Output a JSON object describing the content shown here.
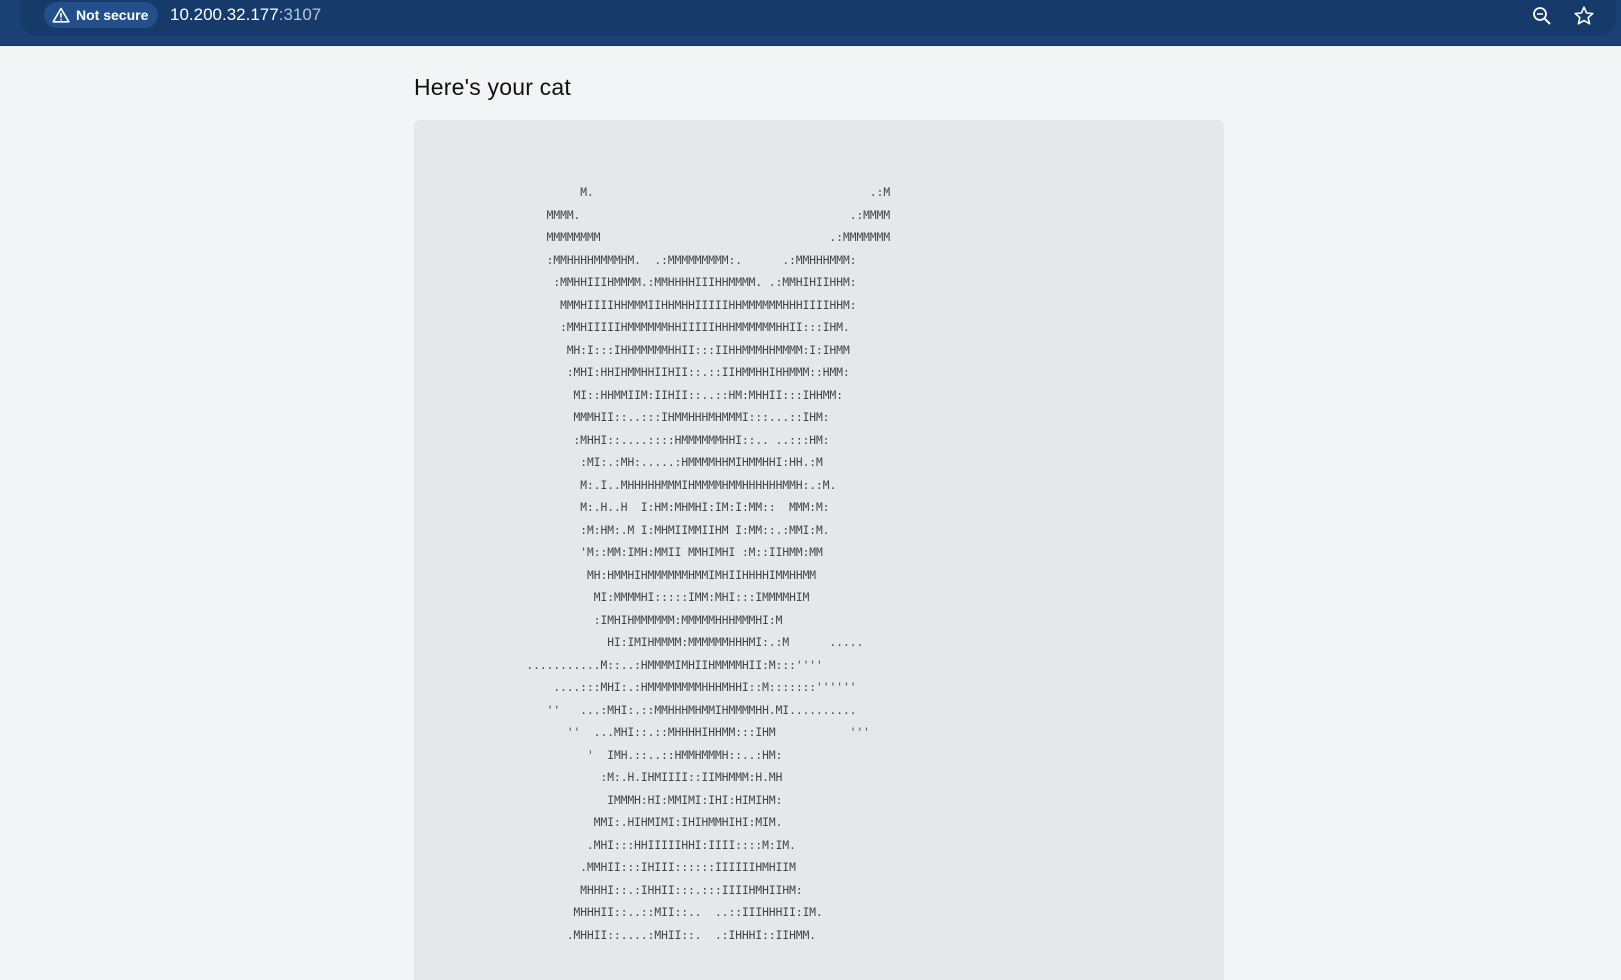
{
  "browser": {
    "security_label": "Not secure",
    "url_host": "10.200.32.177",
    "url_port": ":3107"
  },
  "page": {
    "heading": "Here's your cat"
  },
  "cat_ascii": "              M.                                         .:M\n         MMMM.                                        .:MMMM\n         MMMMMMMM                                  .:MMMMMMM\n         :MMHHHHMMMMHM.  .:MMMMMMMMM:.      .:MMHHHMMM:\n          :MMHHIIIHMMMM.:MMHHHHIIIHHMMMM. .:MMHIHIIHHM:\n           MMMHIIIIHHMMMIIHHMHHIIIIIHHMMMMMMHHHIIIIHHM:\n           :MMHIIIIIHMMMMMMHHIIIIIHHHMMMMMMHHII:::IHM.\n            MH:I:::IHHMMMMMHHII:::IIHHMMMHHMMMM:I:IHMM\n            :MHI:HHIHMMHHIIHII::.::IIHMMHHIHHMMM::HMM:\n             MI::HHMMIIM:IIHII::..::HM:MHHII:::IHHMM:\n             MMMHII::..:::IHMMHHHMHMMMI:::...::IHM:\n             :MHHI::....::::HMMMMMMHHI::.. ..:::HM:\n              :MI:.:MH:.....:HMMMMHHMIHMMHHI:HH.:M\n              M:.I..MHHHHHMMMIHMMMMHMMHHHHHHMMH:.:M.\n              M:.H..H  I:HM:MHMHI:IM:I:MM::  MMM:M:\n              :M:HM:.M I:MHMIIMMIIHM I:MM::.:MMI:M.\n              'M::MM:IMH:MMII MMHIMHI :M::IIHMM:MM\n               MH:HMMHIHMMMMMMHMMIMHIIHHHHIMMHHMM\n                MI:MMMMHI:::::IMM:MHI:::IMMMMHIM\n                :IMHIHMMMMMM:MMMMMHHHMMMHI:M\n                  HI:IMIHMMMM:MMMMMMHHHMI:.:M      .....\n      ...........M::..:HMMMMIMHIIHMMMMHII:M:::''''\n          ....:::MHI:.:HMMMMMMMMHHHMHHI::M:::::::''''''\n         ''   ...:MHI:.::MMHHHMHMMIHMMMMHH.MI..........\n            ''  ...MHI::.::MHHHHIHHMM:::IHM           '''\n               '  IMH.::..::HMMHMMMH::..:HM:\n                 :M:.H.IHMIIII::IIMHMMM:H.MH\n                  IMMMH:HI:MMIMI:IHI:HIMIHM:\n                MMI:.HIHMIMI:IHIHMMHIHI:MIM.\n               .MHI:::HHIIIIIHHI:IIII::::M:IM.\n              .MMHII:::IHIII::::::IIIIIIHMHIIM\n              MHHHI::.:IHHII:::.:::IIIIHMHIIHM:\n             MHHHII::..::MII::..  ..::IIIHHHII:IM.\n            .MHHII::....:MHII::.  .:IHHHI::IIHMM."
}
